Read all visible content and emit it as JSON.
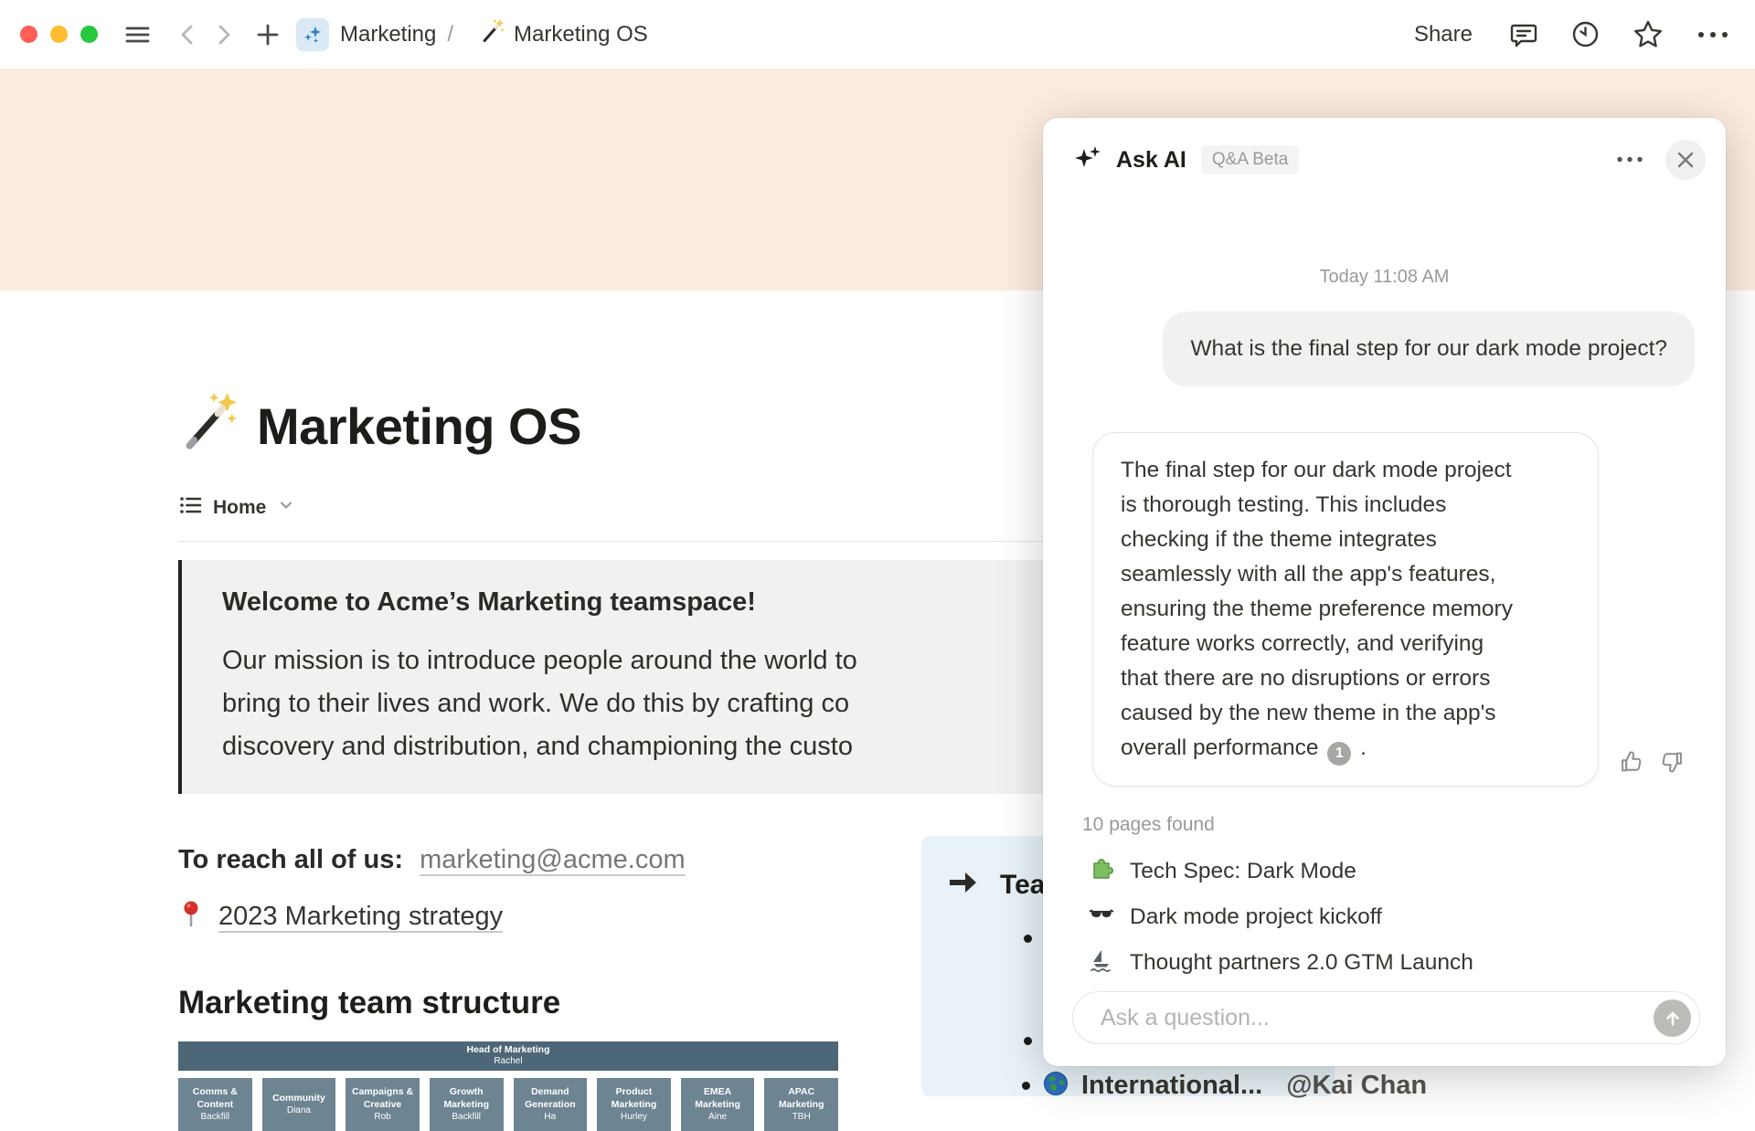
{
  "toolbar": {
    "breadcrumb": {
      "teamspace": "Marketing",
      "separator": "/",
      "page": "Marketing OS"
    },
    "share_label": "Share"
  },
  "page": {
    "title": "Marketing OS",
    "tab": {
      "label": "Home"
    },
    "welcome_callout": {
      "heading": "Welcome to Acme’s Marketing teamspace!",
      "lines": [
        "Our mission is to introduce people around the world to",
        "bring to their lives and work. We do this by crafting co",
        "discovery and distribution, and championing the custo"
      ]
    },
    "contact": {
      "label": "To reach all of us:",
      "email": "marketing@acme.com"
    },
    "strategy_link": {
      "label": "2023 Marketing strategy"
    },
    "team_heading": "Marketing team structure",
    "org_chart": {
      "head": {
        "role": "Head of Marketing",
        "name": "Rachel"
      },
      "boxes": [
        {
          "role": "Comms & Content",
          "name": "Backfill"
        },
        {
          "role": "Community",
          "name": "Diana"
        },
        {
          "role": "Campaigns & Creative",
          "name": "Rob"
        },
        {
          "role": "Growth Marketing",
          "name": "Backfill"
        },
        {
          "role": "Demand Generation",
          "name": "Ha"
        },
        {
          "role": "Product Marketing",
          "name": "Hurley"
        },
        {
          "role": "EMEA Marketing",
          "name": "Aine"
        },
        {
          "role": "APAC Marketing",
          "name": "TBH"
        }
      ]
    },
    "team_callout": {
      "visible_title": "Tea"
    },
    "international_item": {
      "title": "International...",
      "mention": "@Kai Chan"
    }
  },
  "ask_ai": {
    "title": "Ask AI",
    "badge": "Q&A Beta",
    "timestamp": "Today 11:08 AM",
    "question": "What is the final step for our dark mode project?",
    "answer_lines": [
      "The final step for our dark mode project",
      "is thorough testing. This includes",
      "checking if the theme integrates",
      "seamlessly with all the app's features,",
      "ensuring the theme preference memory",
      "feature works correctly, and verifying",
      "that there are no disruptions or errors",
      "caused by the new theme in the app's"
    ],
    "answer_tail": "overall performance",
    "citation": "1",
    "answer_end": ".",
    "pages_found": "10 pages found",
    "pages": [
      {
        "icon": "puzzle-icon",
        "title": "Tech Spec: Dark Mode"
      },
      {
        "icon": "sunglasses-icon",
        "title": "Dark mode project kickoff"
      },
      {
        "icon": "sailboat-icon",
        "title": "Thought partners 2.0 GTM Launch"
      }
    ],
    "input_placeholder": "Ask a question..."
  },
  "colors": {
    "banner": "#fcecdf",
    "callout_bg": "#f1f1ef",
    "blue_callout_bg": "#e8f2f7",
    "org_bar": "#4d6678",
    "org_box": "#6d8492",
    "traffic_red": "#ff5f57",
    "traffic_yellow": "#febc2e",
    "traffic_green": "#28c840",
    "text": "#37352f",
    "muted_text": "#9b9a97"
  }
}
